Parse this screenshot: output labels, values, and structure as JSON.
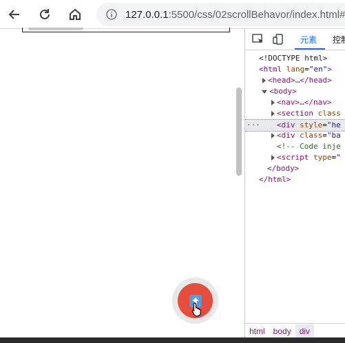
{
  "browser": {
    "url_host": "127.0.0.1",
    "url_rest": ":5500/css/02scrollBehavor/index.html#"
  },
  "devtools": {
    "tabs": [
      "元素",
      "控制"
    ],
    "tree": [
      {
        "kind": "doctype",
        "text": "<!DOCTYPE html>"
      },
      {
        "kind": "open",
        "tag": "html",
        "attr": "lang",
        "val": "\"en\""
      },
      {
        "kind": "collapsed",
        "text": "<head>…</head>"
      },
      {
        "kind": "openexp",
        "text": "<body>"
      },
      {
        "kind": "collapsed",
        "text": "<nav>…</nav>"
      },
      {
        "kind": "collapsedattr",
        "tag": "section",
        "attr": "class"
      },
      {
        "kind": "selected",
        "tag": "div",
        "attr": "style",
        "val": "\"he"
      },
      {
        "kind": "collapsedattr",
        "tag": "div",
        "attr": "class",
        "val": "\"ba"
      },
      {
        "kind": "comment",
        "text": "<!-- Code inje"
      },
      {
        "kind": "collapsedattr",
        "tag": "script",
        "attr": "type",
        "val": "\""
      },
      {
        "kind": "close",
        "text": "</body>"
      },
      {
        "kind": "close",
        "text": "</html>"
      }
    ],
    "breadcrumbs": [
      "html",
      "body",
      "div"
    ]
  },
  "colors": {
    "fab": "#e74c3c",
    "accent": "#1a73e8"
  }
}
